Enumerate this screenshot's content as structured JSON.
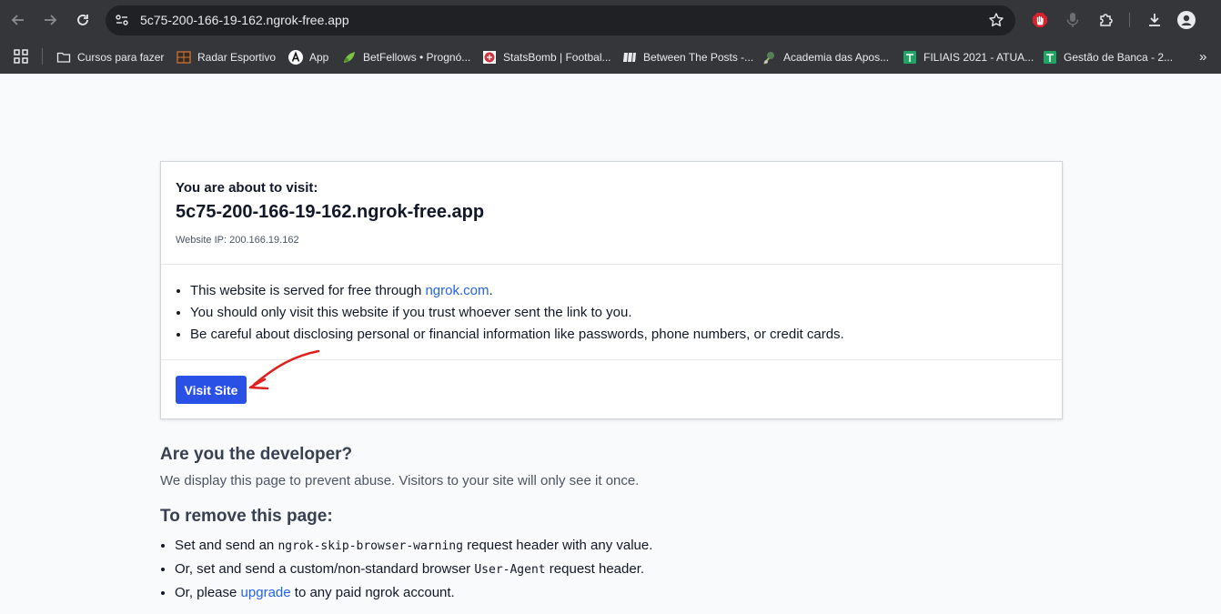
{
  "browser": {
    "url": "5c75-200-166-19-162.ngrok-free.app",
    "bookmarks": [
      {
        "label": "Cursos para fazer",
        "icon": "folder-icon"
      },
      {
        "label": "Radar Esportivo",
        "icon": "radar-esportivo-icon"
      },
      {
        "label": "App",
        "icon": "app-a-icon"
      },
      {
        "label": "BetFellows • Prognó...",
        "icon": "betfellows-icon"
      },
      {
        "label": "StatsBomb | Footbal...",
        "icon": "statsbomb-icon"
      },
      {
        "label": "Between The Posts -...",
        "icon": "btp-icon"
      },
      {
        "label": "Academia das Apos...",
        "icon": "academia-icon"
      },
      {
        "label": "FILIAIS 2021 - ATUA...",
        "icon": "sheets-icon"
      },
      {
        "label": "Gestão de Banca - 2...",
        "icon": "sheets-icon"
      }
    ],
    "more_glyph": "»"
  },
  "warning": {
    "about_label": "You are about to visit:",
    "host": "5c75-200-166-19-162.ngrok-free.app",
    "ip_label": "Website IP: 200.166.19.162",
    "bullets": {
      "b1_pre": "This website is served for free through ",
      "b1_link": "ngrok.com",
      "b1_post": ".",
      "b2": "You should only visit this website if you trust whoever sent the link to you.",
      "b3": "Be careful about disclosing personal or financial information like passwords, phone numbers, or credit cards."
    },
    "visit_button": "Visit Site"
  },
  "developer": {
    "title": "Are you the developer?",
    "text": "We display this page to prevent abuse. Visitors to your site will only see it once."
  },
  "remove": {
    "title": "To remove this page:",
    "i1_pre": "Set and send an ",
    "i1_code": "ngrok-skip-browser-warning",
    "i1_post": " request header with any value.",
    "i2_pre": "Or, set and send a custom/non-standard browser ",
    "i2_code": "User-Agent",
    "i2_post": " request header.",
    "i3_pre": "Or, please ",
    "i3_link": "upgrade",
    "i3_post": " to any paid ngrok account."
  },
  "colors": {
    "chrome": "#35363a",
    "omnibox": "#202124",
    "accent_button": "#2951e6",
    "link": "#2563eb",
    "annotation_arrow": "#e02020"
  }
}
